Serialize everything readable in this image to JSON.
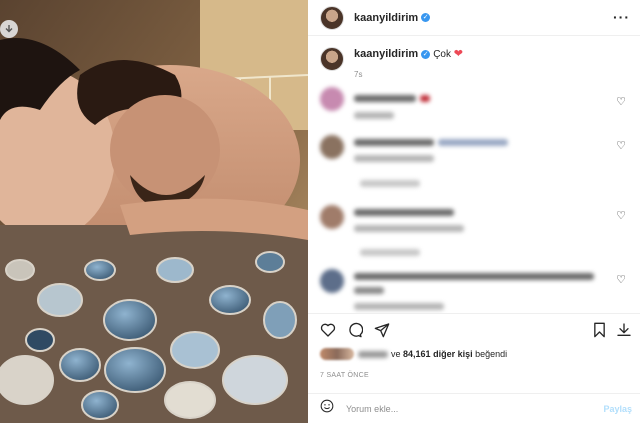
{
  "post": {
    "username": "kaanyildirim",
    "more_icon": "more-horizontal-icon",
    "caption": {
      "text": "Çok",
      "emoji": "❤",
      "time": "7s"
    }
  },
  "comments": [
    {
      "time": "7s",
      "reply": ""
    },
    {
      "time": "7s",
      "reply": ""
    },
    {
      "time": "7s",
      "reply": ""
    },
    {
      "time": "7s",
      "reply": ""
    }
  ],
  "likes": {
    "connector": "ve",
    "count": "84,161",
    "suffix": "diğer kişi",
    "verb": "beğendi"
  },
  "post_time": "7 SAAT ÖNCE",
  "add_comment": {
    "placeholder": "Yorum ekle...",
    "post_label": "Paylaş"
  },
  "colors": {
    "verified": "#3897f0",
    "heart": "#ed4956",
    "post_button": "#b2dffc",
    "border": "#efefef"
  }
}
